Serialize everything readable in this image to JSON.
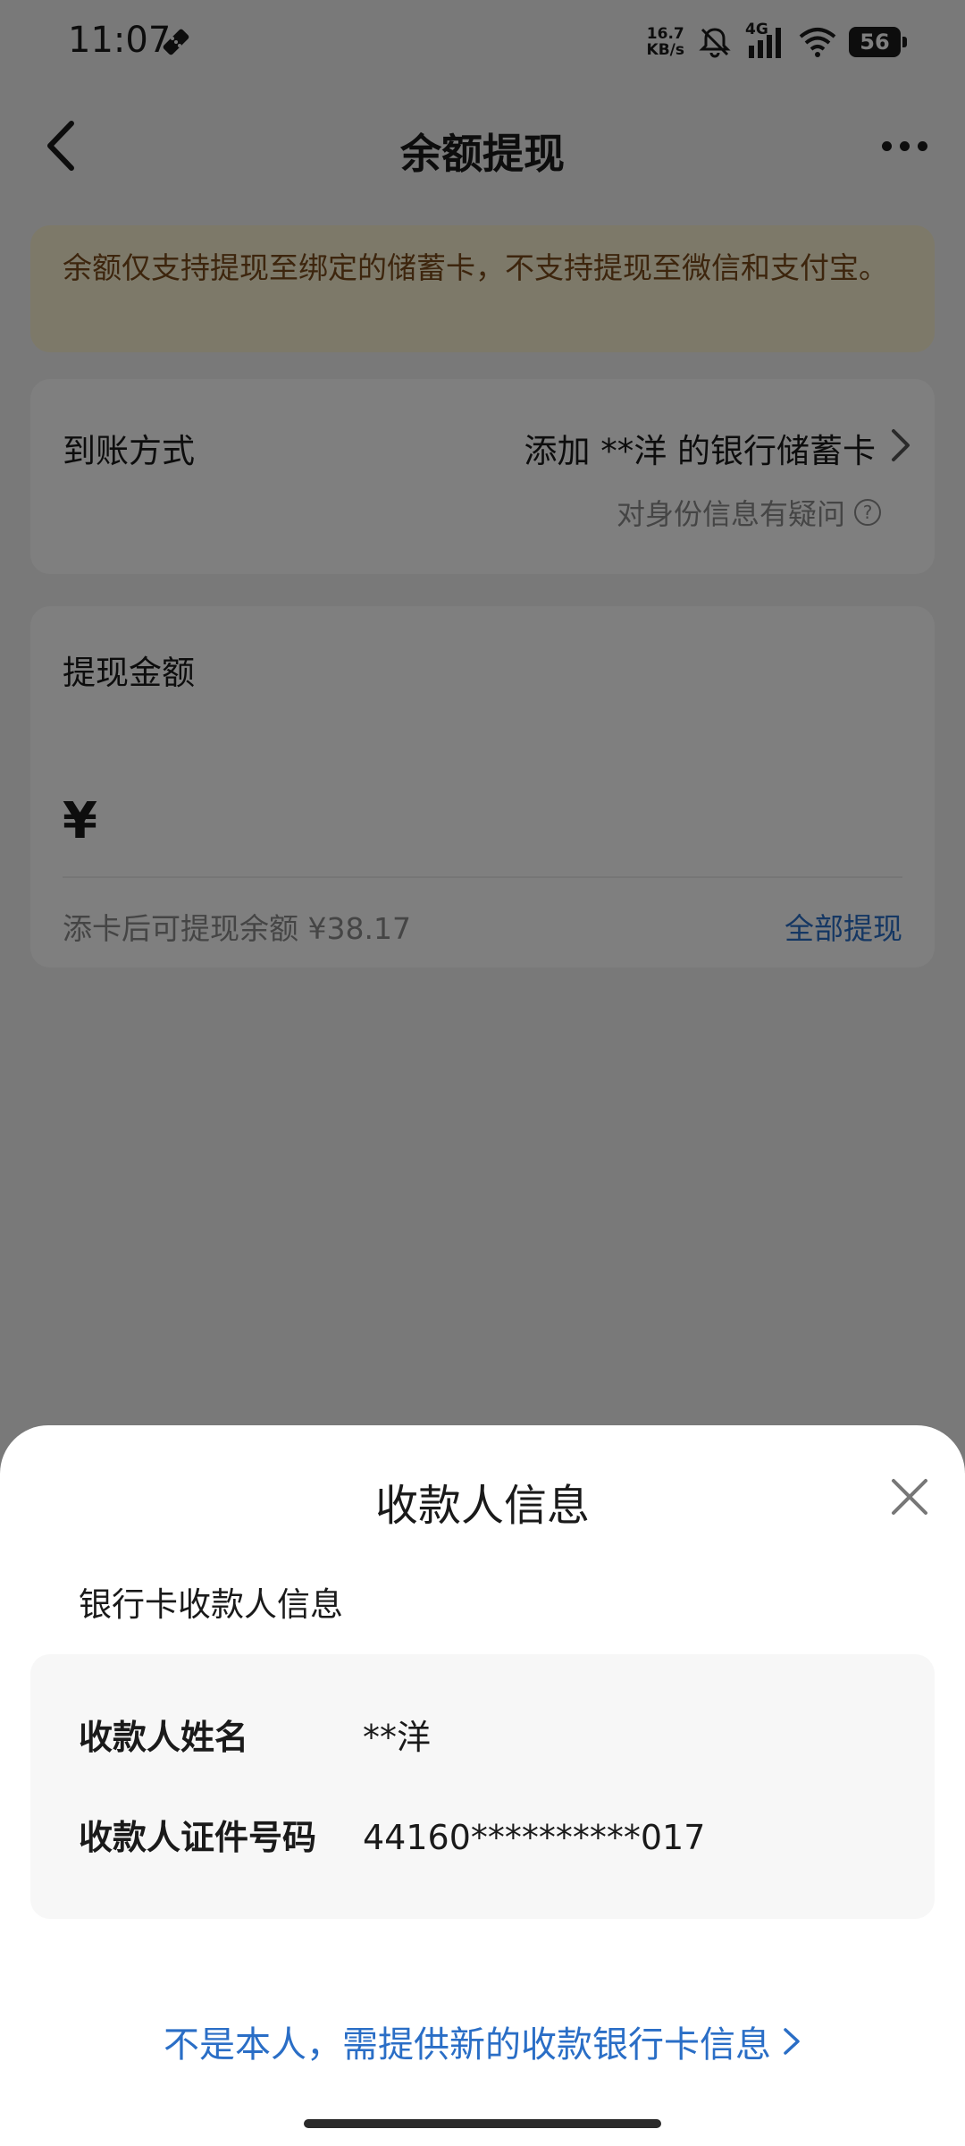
{
  "status_bar": {
    "time": "11:07",
    "speed_value": "16.7",
    "speed_unit": "KB/s",
    "network": "4G",
    "battery": "56"
  },
  "nav": {
    "title": "余额提现",
    "back_icon": "chevron-left-icon",
    "more_icon": "more-dots-icon"
  },
  "notice": {
    "text": "余额仅支持提现至绑定的储蓄卡，不支持提现至微信和支付宝。"
  },
  "method_card": {
    "label": "到账方式",
    "value": "添加 **洋 的银行储蓄卡",
    "sub_text": "对身份信息有疑问",
    "help_icon": "question-circle-icon"
  },
  "amount_card": {
    "label": "提现金额",
    "currency": "¥",
    "amount_value": "",
    "hint": "添卡后可提现余额 ¥38.17",
    "withdraw_all": "全部提现"
  },
  "sheet": {
    "title": "收款人信息",
    "subtitle": "银行卡收款人信息",
    "rows": [
      {
        "label": "收款人姓名",
        "value": "**洋"
      },
      {
        "label": "收款人证件号码",
        "value": "44160**********017"
      }
    ],
    "link": "不是本人，需提供新的收款银行卡信息"
  },
  "colors": {
    "accent": "#2a6ec6",
    "notice_bg": "#fbf2d2",
    "notice_text": "#7a4b1a",
    "overlay": "rgba(0,0,0,0.5)"
  }
}
